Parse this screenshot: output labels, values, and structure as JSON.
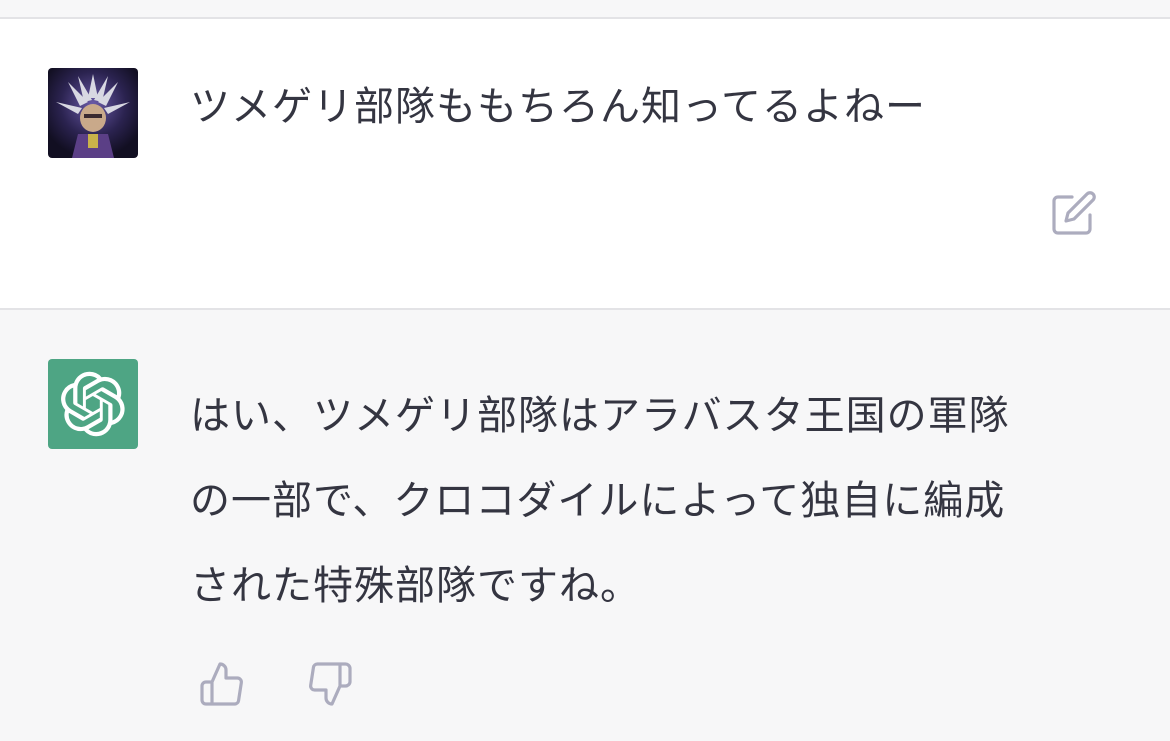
{
  "conversation": {
    "user_message": {
      "avatar": "user-avatar-image",
      "text": "ツメゲリ部隊ももちろん知ってるよねー",
      "actions": {
        "edit_icon": "edit-icon"
      }
    },
    "assistant_message": {
      "avatar": "openai-logo-icon",
      "lines": [
        "はい、ツメゲリ部隊はアラバスタ王国の軍隊",
        "の一部で、クロコダイルによって独自に編成",
        "された特殊部隊ですね。"
      ],
      "actions": {
        "thumbs_up_icon": "thumbs-up-icon",
        "thumbs_down_icon": "thumbs-down-icon"
      }
    }
  },
  "colors": {
    "text": "#343541",
    "icon": "#acacbe",
    "assistant_avatar_bg": "#4ea584",
    "user_block_bg": "#ffffff",
    "assistant_block_bg": "#f7f7f8",
    "divider": "#e3e3e6"
  }
}
